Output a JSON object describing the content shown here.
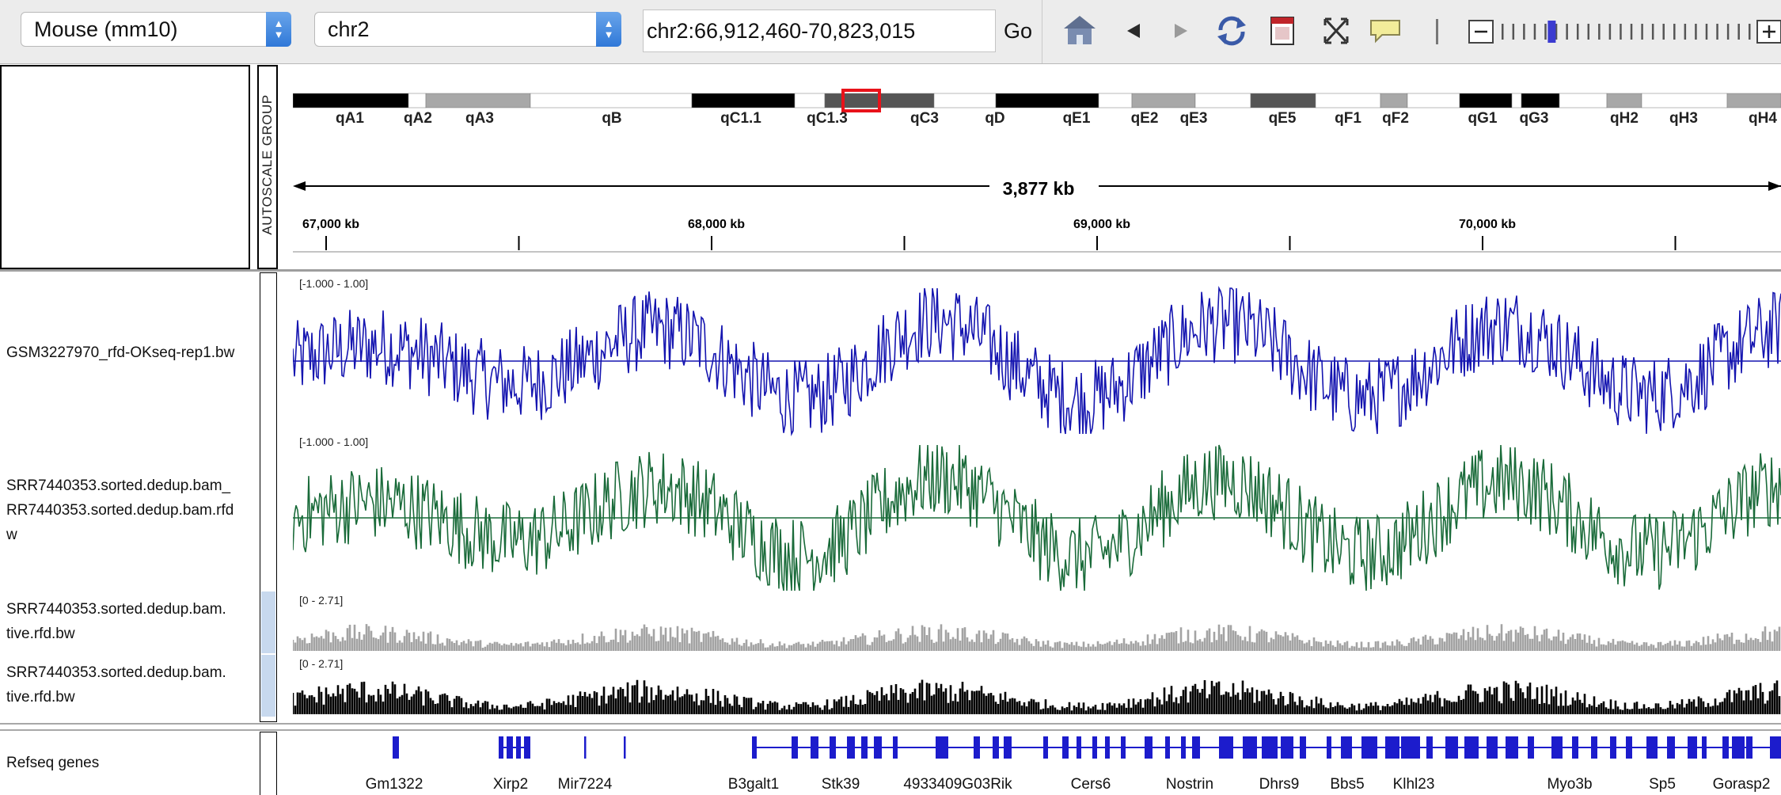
{
  "toolbar": {
    "genome": "Mouse (mm10)",
    "chromosome": "chr2",
    "locus": "chr2:66,912,460-70,823,015",
    "go_label": "Go",
    "zoom_minus": "−",
    "zoom_plus": "+",
    "zoom_level_fraction": 0.2
  },
  "ideogram": {
    "bands": [
      "qA1",
      "qA2",
      "qA3",
      "qB",
      "qC1.1",
      "qC1.3",
      "qC3",
      "qD",
      "qE1",
      "qE2",
      "qE3",
      "qE5",
      "qF1",
      "qF2",
      "qG1",
      "qG3",
      "qH2",
      "qH3",
      "qH4"
    ]
  },
  "ruler": {
    "span": "3,877 kb",
    "ticks": [
      "67,000 kb",
      "68,000 kb",
      "69,000 kb",
      "70,000 kb"
    ]
  },
  "autoscale_label": "AUTOSCALE GROUP",
  "tracks": [
    {
      "name": "GSM3227970_rfd-OKseq-rep1.bw",
      "range": "[-1.000 - 1.00]",
      "color": "#1515b0"
    },
    {
      "name": "SRR7440353.sorted.dedup.bam_\nRR7440353.sorted.dedup.bam.rfd\nw",
      "range": "[-1.000 - 1.00]",
      "color": "#1a6b3a"
    },
    {
      "name": "SRR7440353.sorted.dedup.bam.\ntive.rfd.bw",
      "range": "[0 - 2.71]",
      "color": "#a3a3a3"
    },
    {
      "name": "SRR7440353.sorted.dedup.bam.\ntive.rfd.bw",
      "range": "[0 - 2.71]",
      "color": "#000000"
    }
  ],
  "refseq": {
    "name": "Refseq genes",
    "color": "#1c1ccc",
    "genes": [
      "Gm1322",
      "Xirp2",
      "Mir7224",
      "B3galt1",
      "Stk39",
      "4933409G03Rik",
      "Cers6",
      "Nostrin",
      "Dhrs9",
      "Bbs5",
      "Klhl23",
      "Myo3b",
      "Sp5",
      "Gorasp2"
    ]
  }
}
